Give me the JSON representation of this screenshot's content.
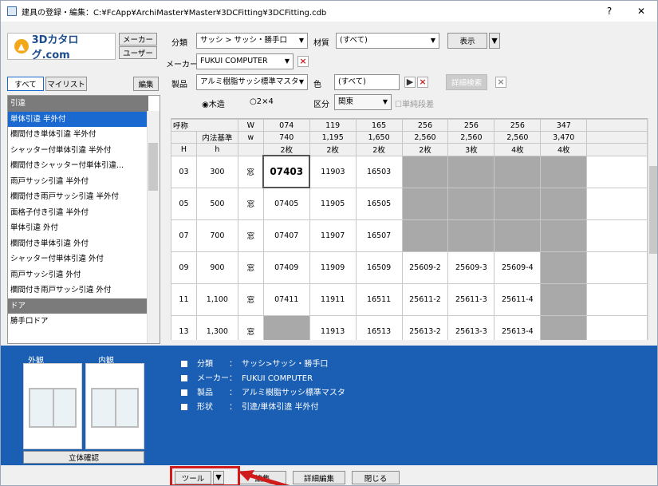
{
  "window": {
    "title": "建具の登録・編集：C:¥FcApp¥ArchiMaster¥Master¥3DCFitting¥3DCFitting.cdb",
    "help": "?",
    "close": "✕"
  },
  "left": {
    "logo": "3Dカタログ.com",
    "maker_btn": "メーカー",
    "user_btn": "ユーザー",
    "tab_all": "すべて",
    "tab_mylist": "マイリスト",
    "edit_btn": "編集",
    "list": [
      {
        "label": "引違",
        "type": "header"
      },
      {
        "label": "単体引違 半外付",
        "type": "selected"
      },
      {
        "label": "欄間付き単体引違 半外付",
        "type": "item"
      },
      {
        "label": "シャッター付単体引違 半外付",
        "type": "item"
      },
      {
        "label": "欄間付きシャッター付単体引違...",
        "type": "item"
      },
      {
        "label": "雨戸サッシ引違 半外付",
        "type": "item"
      },
      {
        "label": "欄間付き雨戸サッシ引違 半外付",
        "type": "item"
      },
      {
        "label": "面格子付き引違 半外付",
        "type": "item"
      },
      {
        "label": "単体引違 外付",
        "type": "item"
      },
      {
        "label": "欄間付き単体引違 外付",
        "type": "item"
      },
      {
        "label": "シャッター付単体引違 外付",
        "type": "item"
      },
      {
        "label": "雨戸サッシ引違 外付",
        "type": "item"
      },
      {
        "label": "欄間付き雨戸サッシ引違 外付",
        "type": "item"
      },
      {
        "label": "ドア",
        "type": "header"
      },
      {
        "label": "勝手口ドア",
        "type": "item"
      }
    ]
  },
  "filters": {
    "bunrui_label": "分類",
    "bunrui_value": "サッシ > サッシ・勝手口",
    "zaishitsu_label": "材質",
    "zaishitsu_value": "(すべて)",
    "hyoji_btn": "表示",
    "maker_label": "メーカー",
    "maker_value": "FUKUI COMPUTER",
    "seihin_label": "製品",
    "seihin_value": "アルミ樹脂サッシ標準マスタ",
    "iro_label": "色",
    "iro_value": "(すべて)",
    "detail_btn": "詳細検索",
    "mokuzo": "木造",
    "twobyfour": "2×4",
    "kubun_label": "区分",
    "kubun_value": "関東",
    "tanjun": "単純段差"
  },
  "grid": {
    "h1": [
      "呼称",
      "W",
      "074",
      "119",
      "165",
      "256",
      "256",
      "256",
      "347"
    ],
    "h2": [
      "内法基準",
      "w",
      "740",
      "1,195",
      "1,650",
      "2,560",
      "2,560",
      "2,560",
      "3,470"
    ],
    "h3": [
      "H",
      "h",
      "",
      "2枚",
      "2枚",
      "2枚",
      "2枚",
      "3枚",
      "4枚",
      "4枚"
    ],
    "rows": [
      {
        "code": "03",
        "h": "300",
        "type": "窓",
        "cells": [
          "07403",
          "11903",
          "16503",
          "",
          "",
          "",
          ""
        ]
      },
      {
        "code": "05",
        "h": "500",
        "type": "窓",
        "cells": [
          "07405",
          "11905",
          "16505",
          "",
          "",
          "",
          ""
        ]
      },
      {
        "code": "07",
        "h": "700",
        "type": "窓",
        "cells": [
          "07407",
          "11907",
          "16507",
          "",
          "",
          "",
          ""
        ]
      },
      {
        "code": "09",
        "h": "900",
        "type": "窓",
        "cells": [
          "07409",
          "11909",
          "16509",
          "25609-2",
          "25609-3",
          "25609-4",
          ""
        ]
      },
      {
        "code": "11",
        "h": "1,100",
        "type": "窓",
        "cells": [
          "07411",
          "11911",
          "16511",
          "25611-2",
          "25611-3",
          "25611-4",
          ""
        ]
      },
      {
        "code": "13",
        "h": "1,300",
        "type": "窓",
        "cells": [
          "",
          "11913",
          "16513",
          "25613-2",
          "25613-3",
          "25613-4",
          ""
        ]
      }
    ]
  },
  "info": {
    "ext_label": "外観",
    "int_label": "内観",
    "rittai_btn": "立体確認",
    "rows": [
      {
        "k": "分類",
        "v": "サッシ>サッシ・勝手口"
      },
      {
        "k": "メーカー",
        "v": "FUKUI COMPUTER"
      },
      {
        "k": "製品",
        "v": "アルミ樹脂サッシ標準マスタ"
      },
      {
        "k": "形状",
        "v": "引違/単体引違 半外付"
      }
    ]
  },
  "footer": {
    "tool": "ツール",
    "btn2": "編集",
    "detail_edit": "詳細編集",
    "close": "閉じる"
  }
}
